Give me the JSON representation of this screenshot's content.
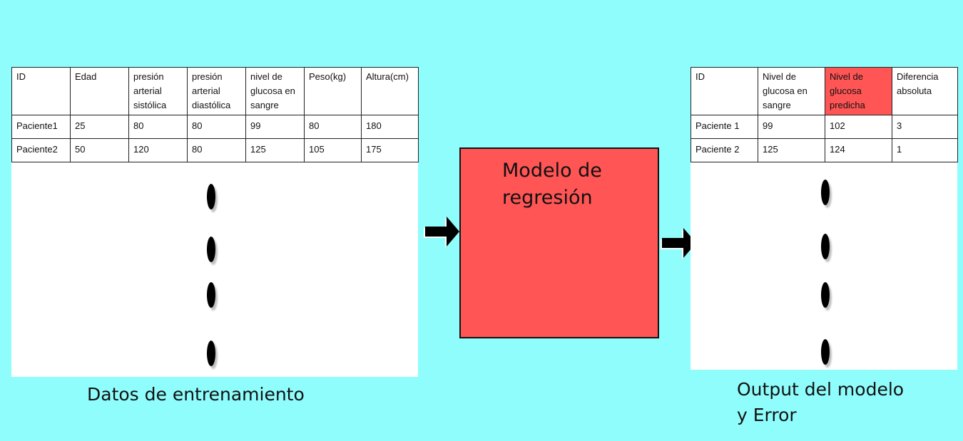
{
  "training_table": {
    "headers": [
      "ID",
      "Edad",
      "presión arterial sistólica",
      "presión arterial diastólica",
      "nivel de glucosa en sangre",
      "Peso(kg)",
      "Altura(cm)"
    ],
    "rows": [
      [
        "Paciente1",
        "25",
        "80",
        "80",
        "99",
        "80",
        "180"
      ],
      [
        "Paciente2",
        "50",
        "120",
        "80",
        "125",
        "105",
        "175"
      ]
    ]
  },
  "model": {
    "label_line1": "Modelo de",
    "label_line2": "regresión",
    "color": "#ff5555"
  },
  "output_table": {
    "headers": [
      "ID",
      "Nivel de glucosa en sangre",
      "Nivel de glucosa predicha",
      "Diferencia absoluta"
    ],
    "rows": [
      [
        "Paciente 1",
        "99",
        "102",
        "3"
      ],
      [
        "Paciente 2",
        "125",
        "124",
        "1"
      ]
    ],
    "highlight_color": "#ff5555"
  },
  "captions": {
    "training": "Datos de entrenamiento",
    "output_line1": "Output del modelo",
    "output_line2": "y Error"
  },
  "colors": {
    "background": "#8ffdfc",
    "panel": "#ffffff"
  }
}
